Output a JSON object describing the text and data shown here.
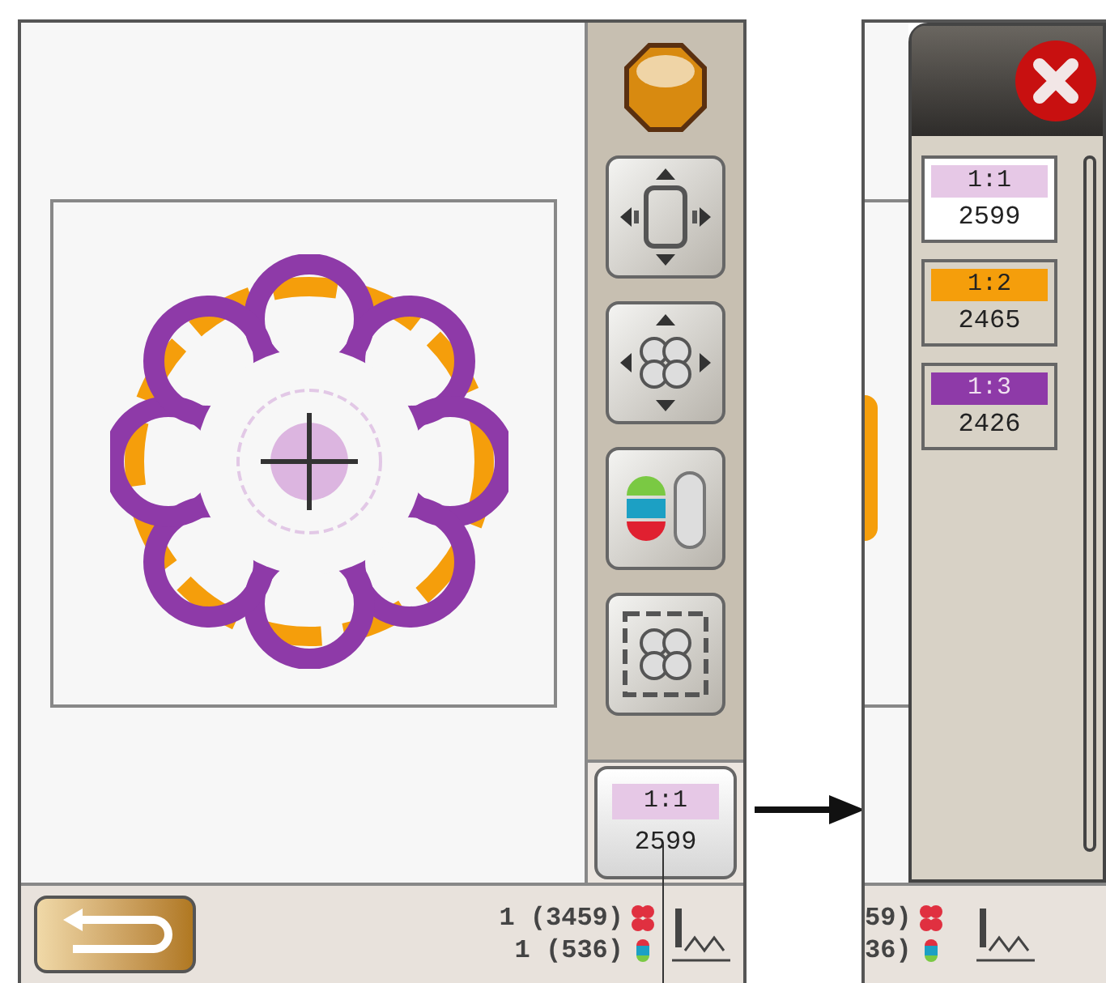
{
  "main_screen": {
    "thread_button": {
      "label": "1:1",
      "count": "2599",
      "color": "#e6c8e6"
    },
    "status": {
      "stitch_count": "1 (3459)",
      "color_count": "1 (536)"
    }
  },
  "color_list_screen": {
    "status_partial": [
      "59)",
      "36)"
    ],
    "colors": [
      {
        "label": "1:1",
        "count": "2599",
        "color": "#e6c8e6",
        "selected": true
      },
      {
        "label": "1:2",
        "count": "2465",
        "color": "#f59e0b",
        "selected": false
      },
      {
        "label": "1:3",
        "count": "2426",
        "color": "#8e3aa8",
        "selected": false
      }
    ]
  }
}
